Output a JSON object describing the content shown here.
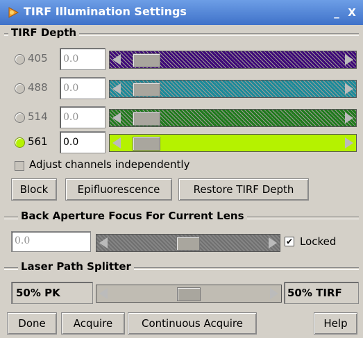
{
  "window": {
    "title": "TIRF Illumination Settings",
    "minimize_glyph": "_",
    "close_glyph": "X"
  },
  "tirf_depth": {
    "group_label": "TIRF Depth",
    "channels": [
      {
        "label": "405",
        "value": "0.0",
        "selected": false,
        "slider_fraction": 0.05,
        "color": "#3d0878"
      },
      {
        "label": "488",
        "value": "0.0",
        "selected": false,
        "slider_fraction": 0.05,
        "color": "#1a8a9a"
      },
      {
        "label": "514",
        "value": "0.0",
        "selected": false,
        "slider_fraction": 0.05,
        "color": "#1f7a1c"
      },
      {
        "label": "561",
        "value": "0.0",
        "selected": true,
        "slider_fraction": 0.05,
        "color": "#b5f200"
      }
    ],
    "adjust_independently_label": "Adjust channels independently",
    "adjust_independently_checked": false,
    "buttons": {
      "block": "Block",
      "epifluorescence": "Epifluorescence",
      "restore": "Restore TIRF Depth"
    }
  },
  "back_aperture": {
    "group_label": "Back Aperture Focus For Current Lens",
    "value": "0.0",
    "slider_fraction": 0.5,
    "locked_label": "Locked",
    "locked_checked": true
  },
  "laser_path": {
    "group_label": "Laser Path Splitter",
    "left_value": "50% PK",
    "right_value": "50% TIRF",
    "slider_fraction": 0.5
  },
  "footer": {
    "done": "Done",
    "acquire": "Acquire",
    "continuous": "Continuous Acquire",
    "help": "Help"
  }
}
